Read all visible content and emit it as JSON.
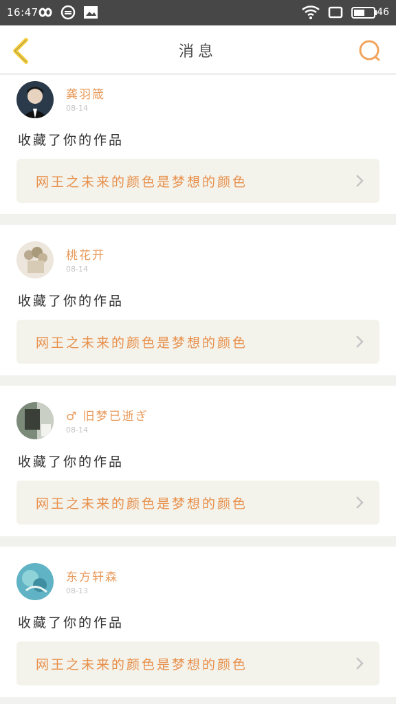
{
  "status_bar": {
    "time": "16:47",
    "battery": "46",
    "icons": [
      "infinity-icon",
      "sync-icon",
      "image-icon",
      "wifi-icon",
      "screen-icon",
      "battery-icon"
    ]
  },
  "header": {
    "title": "消息",
    "back_icon": "chevron-left-icon",
    "search_icon": "search-icon",
    "accent_color": "#f0a45c"
  },
  "messages": [
    {
      "username": "龚羽箴",
      "date": "08-14",
      "action": "收藏了你的作品",
      "work_title": "网王之未来的颜色是梦想的颜色"
    },
    {
      "username": "桃花开",
      "date": "08-14",
      "action": "收藏了你的作品",
      "work_title": "网王之未来的颜色是梦想的颜色"
    },
    {
      "username": "♂ 旧梦已逝ぎ",
      "date": "08-14",
      "action": "收藏了你的作品",
      "work_title": "网王之未来的颜色是梦想的颜色"
    },
    {
      "username": "东方轩森",
      "date": "08-13",
      "action": "收藏了你的作品",
      "work_title": "网王之未来的颜色是梦想的颜色"
    }
  ]
}
